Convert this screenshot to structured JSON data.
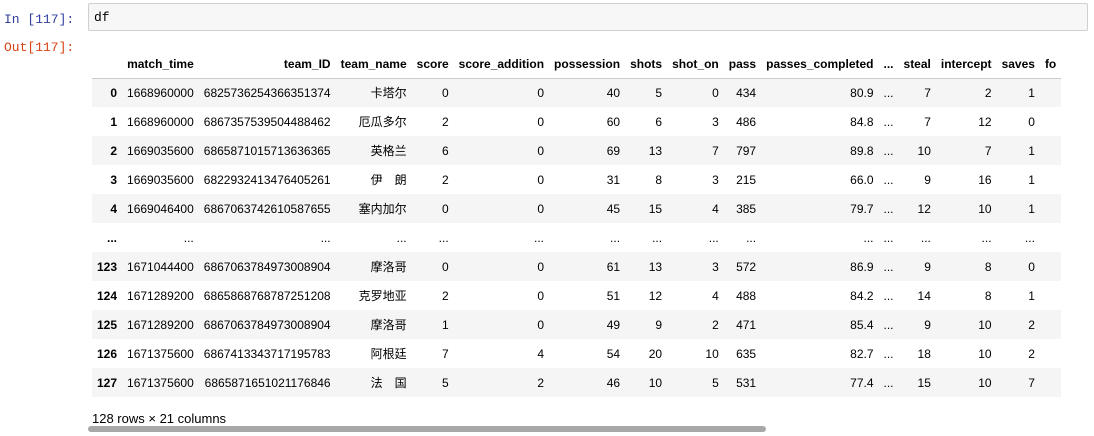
{
  "cells": {
    "in_prompt": "In [117]:",
    "out_prompt": "Out[117]:",
    "code": "df"
  },
  "table": {
    "columns": [
      "",
      "match_time",
      "team_ID",
      "team_name",
      "score",
      "score_addition",
      "possession",
      "shots",
      "shot_on",
      "pass",
      "passes_completed",
      "...",
      "steal",
      "intercept",
      "saves",
      "fo"
    ],
    "rows": [
      [
        "0",
        "1668960000",
        "6825736254366351374",
        "卡塔尔",
        "0",
        "0",
        "40",
        "5",
        "0",
        "434",
        "80.9",
        "...",
        "7",
        "2",
        "1",
        ""
      ],
      [
        "1",
        "1668960000",
        "6867357539504488462",
        "厄瓜多尔",
        "2",
        "0",
        "60",
        "6",
        "3",
        "486",
        "84.8",
        "...",
        "7",
        "12",
        "0",
        ""
      ],
      [
        "2",
        "1669035600",
        "6865871015713636365",
        "英格兰",
        "6",
        "0",
        "69",
        "13",
        "7",
        "797",
        "89.8",
        "...",
        "10",
        "7",
        "1",
        ""
      ],
      [
        "3",
        "1669035600",
        "6822932413476405261",
        "伊　朗",
        "2",
        "0",
        "31",
        "8",
        "3",
        "215",
        "66.0",
        "...",
        "9",
        "16",
        "1",
        ""
      ],
      [
        "4",
        "1669046400",
        "6867063742610587655",
        "塞内加尔",
        "0",
        "0",
        "45",
        "15",
        "4",
        "385",
        "79.7",
        "...",
        "12",
        "10",
        "1",
        ""
      ],
      [
        "...",
        "...",
        "...",
        "...",
        "...",
        "...",
        "...",
        "...",
        "...",
        "...",
        "...",
        "...",
        "...",
        "...",
        "...",
        ""
      ],
      [
        "123",
        "1671044400",
        "6867063784973008904",
        "摩洛哥",
        "0",
        "0",
        "61",
        "13",
        "3",
        "572",
        "86.9",
        "...",
        "9",
        "8",
        "0",
        ""
      ],
      [
        "124",
        "1671289200",
        "6865868768787251208",
        "克罗地亚",
        "2",
        "0",
        "51",
        "12",
        "4",
        "488",
        "84.2",
        "...",
        "14",
        "8",
        "1",
        ""
      ],
      [
        "125",
        "1671289200",
        "6867063784973008904",
        "摩洛哥",
        "1",
        "0",
        "49",
        "9",
        "2",
        "471",
        "85.4",
        "...",
        "9",
        "10",
        "2",
        ""
      ],
      [
        "126",
        "1671375600",
        "6867413343717195783",
        "阿根廷",
        "7",
        "4",
        "54",
        "20",
        "10",
        "635",
        "82.7",
        "...",
        "18",
        "10",
        "2",
        ""
      ],
      [
        "127",
        "1671375600",
        "6865871651021176846",
        "法　国",
        "5",
        "2",
        "46",
        "10",
        "5",
        "531",
        "77.4",
        "...",
        "15",
        "10",
        "7",
        ""
      ]
    ]
  },
  "footer": "128 rows × 21 columns"
}
